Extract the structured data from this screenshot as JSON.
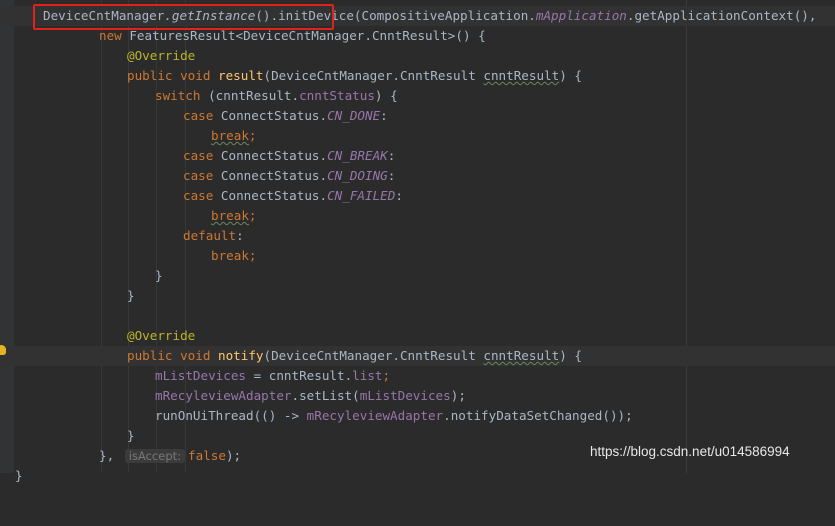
{
  "watermark": "https://blog.csdn.net/u014586994",
  "inlay_hint": "isAccept:",
  "lines": {
    "l1": {
      "class1": "DeviceCntManager",
      "get_instance": "getInstance",
      "call1": "().initDevice(",
      "class2": "CompositiveApplication",
      "dot": ".",
      "mapp": "mApplication",
      "ctx": ".getApplicationContext(),"
    },
    "l2": {
      "new": "new",
      "type": " FeaturesResult<DeviceCntManager.CnntResult>() {"
    },
    "l3": {
      "text": "@Override"
    },
    "l4": {
      "mods": "public void ",
      "name": "result",
      "params": "(DeviceCntManager.CnntResult ",
      "arg": "cnntResult",
      "close": ") {"
    },
    "l5": {
      "kw": "switch",
      "open": " (cnntResult.",
      "field": "cnntStatus",
      "close": ") {"
    },
    "l6": {
      "kw": "case",
      "cls": " ConnectStatus.",
      "const": "CN_DONE",
      "colon": ":"
    },
    "l7": {
      "kw": "break",
      "semi": ";"
    },
    "l8": {
      "kw": "case",
      "cls": " ConnectStatus.",
      "const": "CN_BREAK",
      "colon": ":"
    },
    "l9": {
      "kw": "case",
      "cls": " ConnectStatus.",
      "const": "CN_DOING",
      "colon": ":"
    },
    "l10": {
      "kw": "case",
      "cls": " ConnectStatus.",
      "const": "CN_FAILED",
      "colon": ":"
    },
    "l11": {
      "kw": "break",
      "semi": ";"
    },
    "l12": {
      "kw": "default",
      "colon": ":"
    },
    "l13": {
      "kw": "break",
      "semi": ";"
    },
    "l14": {
      "text": "}"
    },
    "l15": {
      "text": "}"
    },
    "l17": {
      "text": "@Override"
    },
    "l18": {
      "mods": "public void ",
      "name": "notify",
      "params": "(DeviceCntManager.CnntResult ",
      "arg": "cnntResult",
      "close": ") {"
    },
    "l19": {
      "field": "mListDevices",
      "eq": " = cnntResult.",
      "field2": "list",
      "semi": ";"
    },
    "l20": {
      "field": "mRecyleviewAdapter",
      "call": ".setList(",
      "field2": "mListDevices",
      "close": ");"
    },
    "l21": {
      "call": "runOnUiThread(() -> ",
      "field": "mRecyleviewAdapter",
      "call2": ".notifyDataSetChanged());"
    },
    "l22": {
      "text": "}"
    },
    "l23": {
      "pre": "}, ",
      "kw": "false",
      "close": ");"
    },
    "l24": {
      "text": "}"
    }
  }
}
